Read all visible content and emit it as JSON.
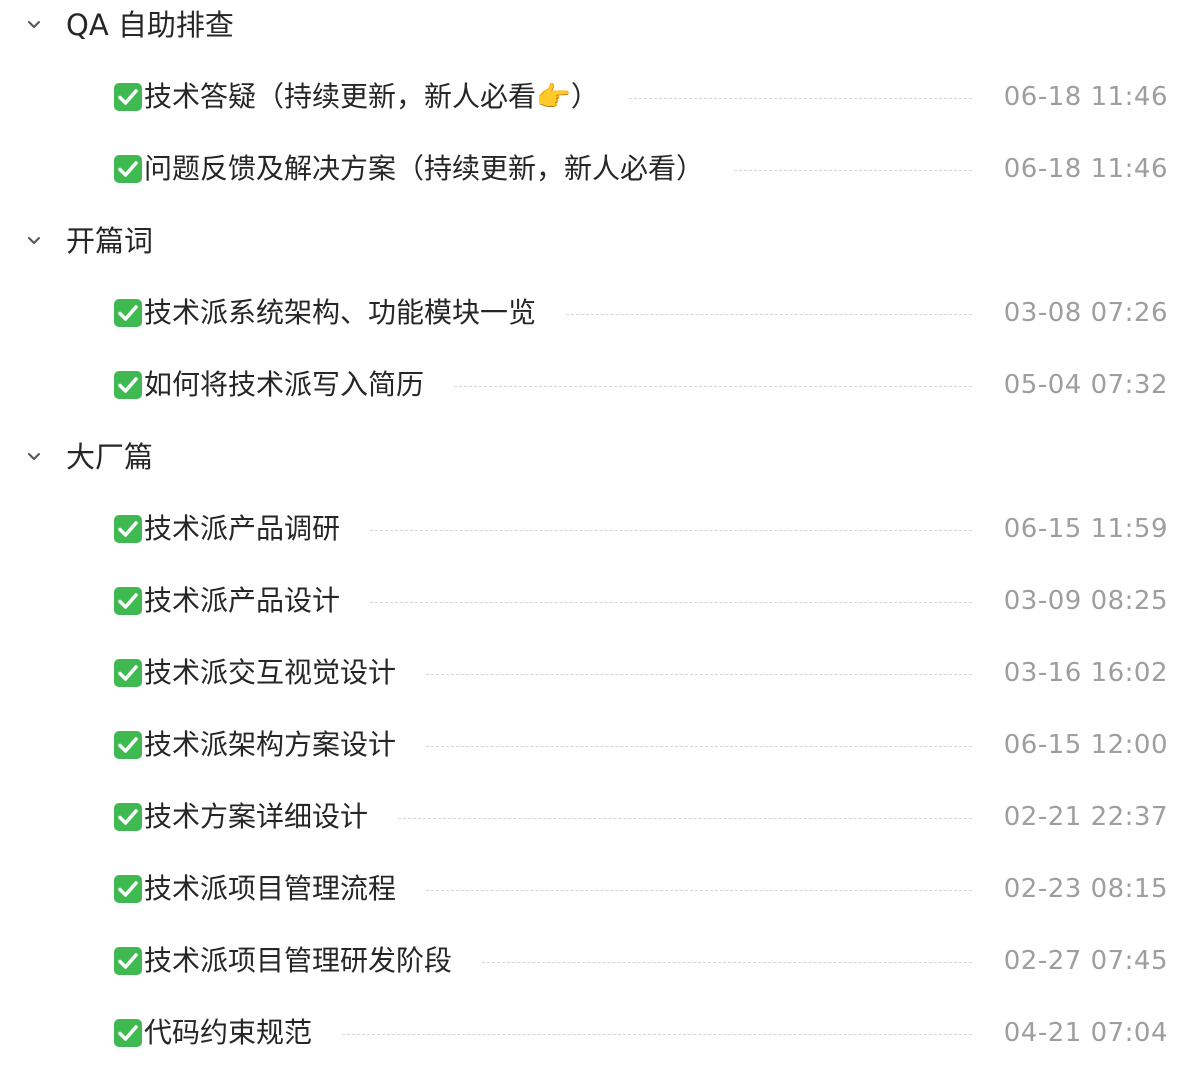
{
  "sections": [
    {
      "title": "QA 自助排查",
      "icon": "chevron-down-icon",
      "items": [
        {
          "title": "技术答疑（持续更新，新人必看",
          "emoji": "👉",
          "suffix": "）",
          "date": "06-18 11:46"
        },
        {
          "title": "问题反馈及解决方案（持续更新，新人必看）",
          "date": "06-18 11:46"
        }
      ]
    },
    {
      "title": "开篇词",
      "icon": "chevron-down-icon",
      "items": [
        {
          "title": "技术派系统架构、功能模块一览",
          "date": "03-08 07:26"
        },
        {
          "title": "如何将技术派写入简历",
          "date": "05-04 07:32"
        }
      ]
    },
    {
      "title": "大厂篇",
      "icon": "chevron-down-icon",
      "items": [
        {
          "title": "技术派产品调研",
          "date": "06-15 11:59"
        },
        {
          "title": "技术派产品设计",
          "date": "03-09 08:25"
        },
        {
          "title": "技术派交互视觉设计",
          "date": "03-16 16:02"
        },
        {
          "title": "技术派架构方案设计",
          "date": "06-15 12:00"
        },
        {
          "title": "技术方案详细设计",
          "date": "02-21 22:37"
        },
        {
          "title": "技术派项目管理流程",
          "date": "02-23 08:15"
        },
        {
          "title": "技术派项目管理研发阶段",
          "date": "02-27 07:45"
        },
        {
          "title": "代码约束规范",
          "date": "04-21 07:04"
        }
      ]
    }
  ],
  "colors": {
    "check_green": "#3fb950",
    "text": "#262626",
    "date": "#9e9e9e",
    "leader": "#d4d4d4"
  },
  "icons": {
    "item_status": "check-mark-button-icon"
  }
}
